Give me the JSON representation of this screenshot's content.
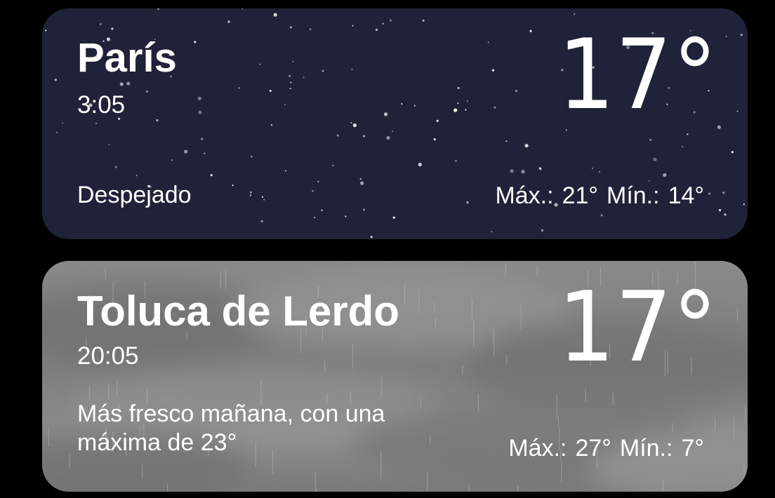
{
  "cards": [
    {
      "city": "París",
      "time": "3:05",
      "temperature": "17°",
      "condition": "Despejado",
      "high_label": "Máx.:",
      "high": "21°",
      "low_label": "Mín.:",
      "low": "14°",
      "background": "night-clear",
      "color": "#1f2238"
    },
    {
      "city": "Toluca de Lerdo",
      "time": "20:05",
      "temperature": "17°",
      "condition": "Más fresco mañana, con una máxima de 23°",
      "high_label": "Máx.:",
      "high": "27°",
      "low_label": "Mín.:",
      "low": "7°",
      "background": "cloudy-rain",
      "color": "#808080"
    }
  ]
}
